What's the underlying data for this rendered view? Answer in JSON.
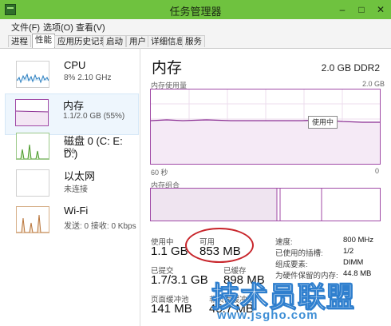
{
  "window": {
    "title": "任务管理器",
    "minimize": "–",
    "maximize": "□",
    "close": "✕"
  },
  "menu": [
    "文件(F)",
    "选项(O)",
    "查看(V)"
  ],
  "tabs": [
    "进程",
    "性能",
    "应用历史记录",
    "启动",
    "用户",
    "详细信息",
    "服务"
  ],
  "active_tab": "性能",
  "sidebar": [
    {
      "name": "CPU",
      "sub": "8% 2.10 GHz"
    },
    {
      "name": "内存",
      "sub": "1.1/2.0 GB (55%)"
    },
    {
      "name": "磁盘 0 (C: E: D:)",
      "sub": "0%"
    },
    {
      "name": "以太网",
      "sub": "未连接"
    },
    {
      "name": "Wi-Fi",
      "sub": "发送: 0 接收: 0 Kbps"
    }
  ],
  "main": {
    "heading": "内存",
    "capacity": "2.0 GB DDR2",
    "usage_label": "内存使用量",
    "usage_max": "2.0 GB",
    "time_left": "60 秒",
    "time_right": "0",
    "tooltip": "使用中",
    "composition_label": "内存组合",
    "in_use_fraction": 0.55
  },
  "stats": {
    "in_use_label": "使用中",
    "in_use_value": "1.1 GB",
    "available_label": "可用",
    "available_value": "853 MB",
    "committed_label": "已提交",
    "committed_value": "1.7/3.1 GB",
    "cached_label": "已缓存",
    "cached_value": "898 MB",
    "paged_label": "页面缓冲池",
    "paged_value": "141 MB",
    "nonpaged_label": "非页面缓冲池",
    "nonpaged_value": "45.7 MB"
  },
  "right_stats": [
    {
      "label": "速度:",
      "value": "800 MHz"
    },
    {
      "label": "已使用的插槽:",
      "value": "1/2"
    },
    {
      "label": "组成要素:",
      "value": "DIMM"
    },
    {
      "label": "为硬件保留的内存:",
      "value": "44.8 MB"
    }
  ],
  "watermark": {
    "text": "技术员联盟",
    "url": "www.jsgho.com"
  },
  "colors": {
    "accent": "#6fc23f",
    "memory": "#8b2f93",
    "cpu": "#2c7fc0",
    "disk": "#4a9a2a",
    "wifi": "#b8743a",
    "highlight": "#c8262c"
  }
}
